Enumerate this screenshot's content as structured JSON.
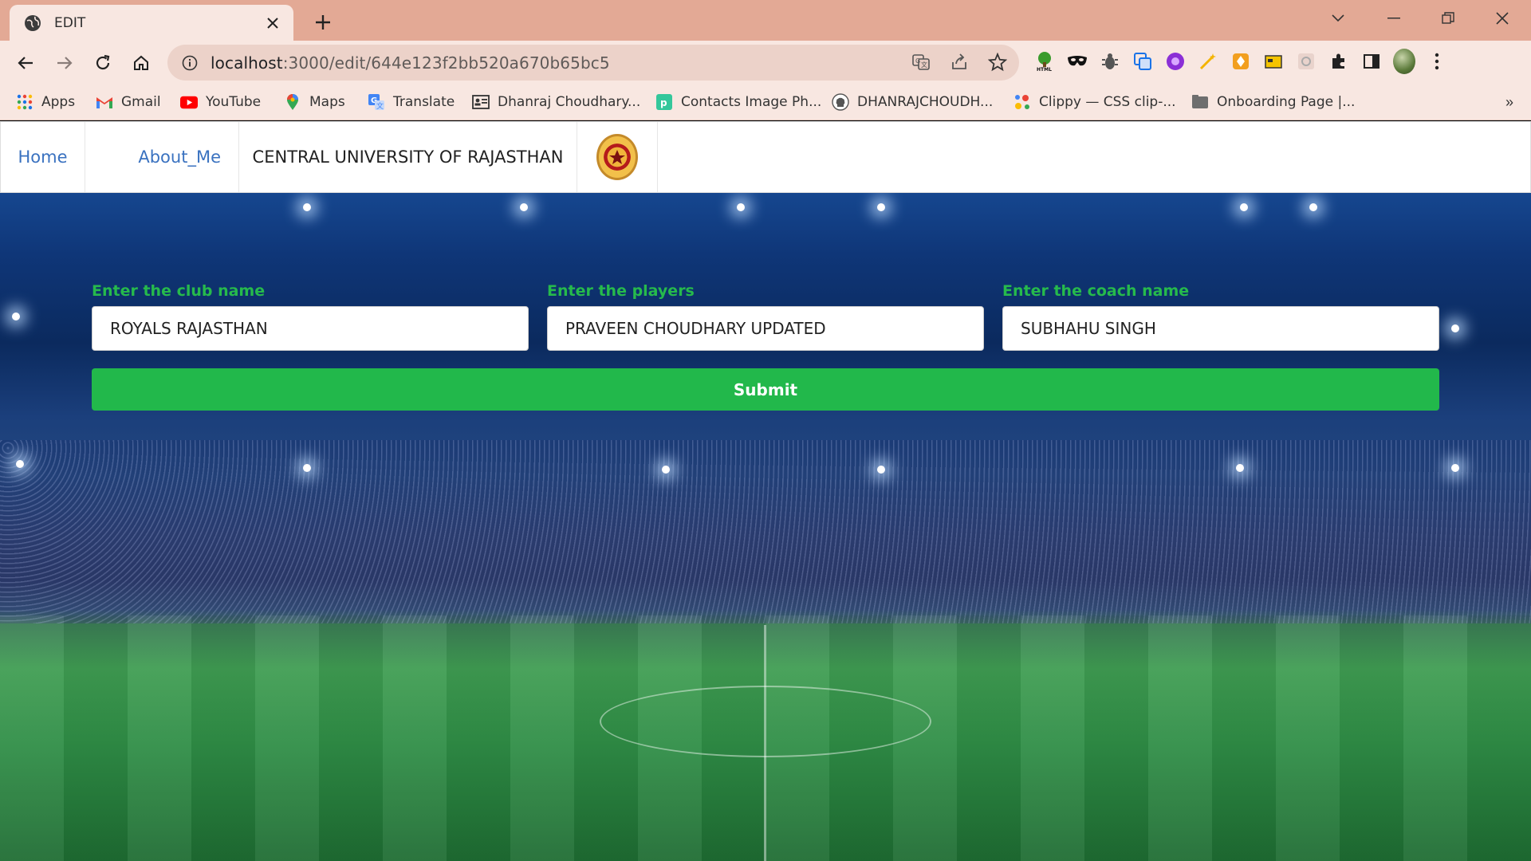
{
  "browser": {
    "tab": {
      "title": "EDIT",
      "favicon": "globe-icon"
    },
    "url": {
      "host": "localhost",
      "path": ":3000/edit/644e123f2bb520a670b65bc5"
    },
    "bookmarks": [
      {
        "label": "Apps",
        "icon": "apps-grid-icon"
      },
      {
        "label": "Gmail",
        "icon": "gmail-icon"
      },
      {
        "label": "YouTube",
        "icon": "youtube-icon"
      },
      {
        "label": "Maps",
        "icon": "maps-pin-icon"
      },
      {
        "label": "Translate",
        "icon": "translate-icon"
      },
      {
        "label": "Dhanraj Choudhary...",
        "icon": "id-card-icon"
      },
      {
        "label": "Contacts Image Ph...",
        "icon": "contacts-icon"
      },
      {
        "label": "DHANRAJCHOUDH...",
        "icon": "github-icon"
      },
      {
        "label": "Clippy — CSS clip-...",
        "icon": "clippy-icon"
      },
      {
        "label": "Onboarding Page |...",
        "icon": "folder-icon"
      }
    ]
  },
  "site": {
    "nav": {
      "home": "Home",
      "about": "About_Me",
      "title": "CENTRAL UNIVERSITY OF RAJASTHAN",
      "logo_icon": "university-seal-icon"
    },
    "form": {
      "club": {
        "label": "Enter the club name",
        "value": "ROYALS RAJASTHAN"
      },
      "players": {
        "label": "Enter the players",
        "value": "PRAVEEN CHOUDHARY UPDATED"
      },
      "coach": {
        "label": "Enter the coach name",
        "value": "SUBHAHU SINGH"
      },
      "submit": "Submit"
    }
  },
  "colors": {
    "accent_green": "#22b84b",
    "label_green": "#26ba4c",
    "nav_link_blue": "#3a72c0",
    "chrome_pink": "#e3a995"
  }
}
